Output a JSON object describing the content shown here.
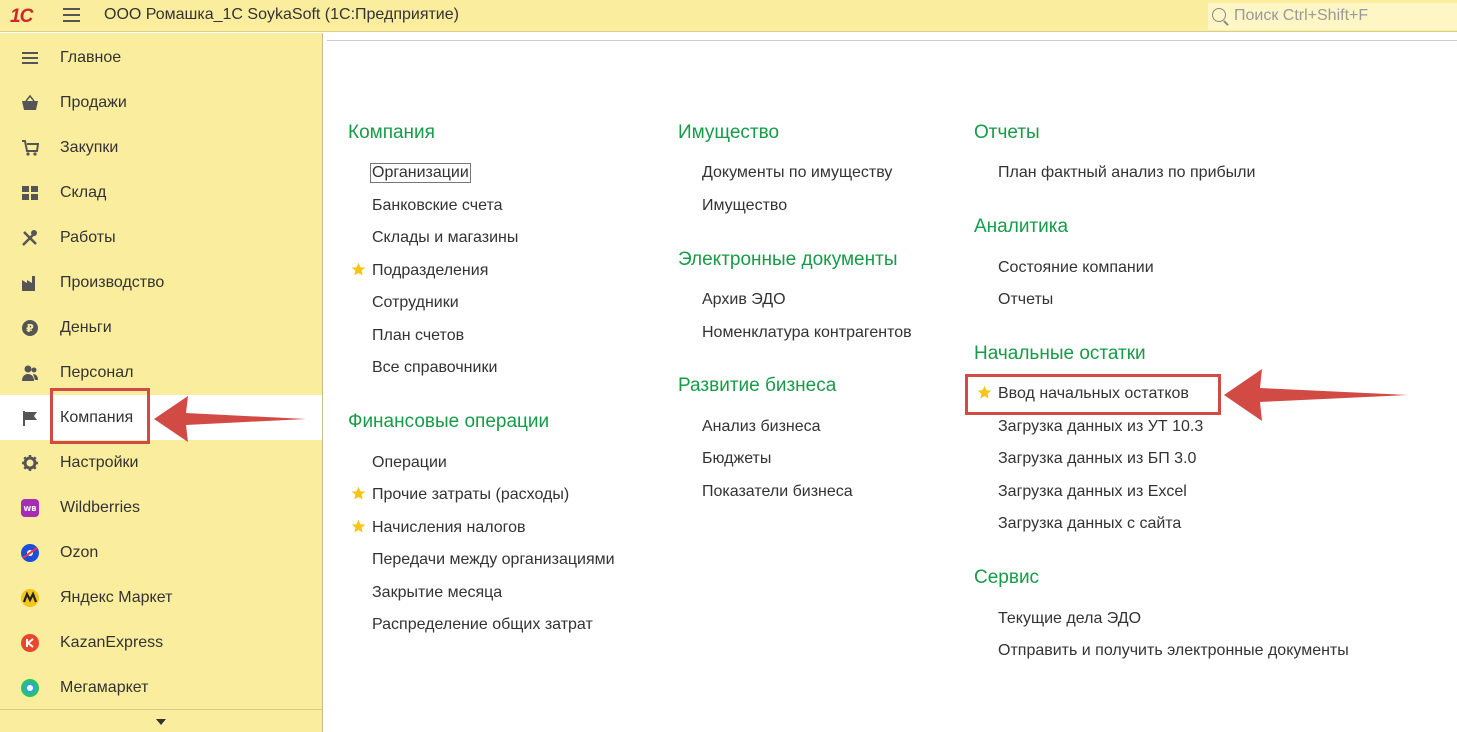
{
  "header": {
    "logo": "1С",
    "title": "ООО Ромашка_1С SoykaSoft  (1С:Предприятие)",
    "search_placeholder": "Поиск Ctrl+Shift+F"
  },
  "sidebar": {
    "items": [
      {
        "label": "Главное",
        "icon": "menu-list-icon"
      },
      {
        "label": "Продажи",
        "icon": "basket-icon"
      },
      {
        "label": "Закупки",
        "icon": "cart-icon"
      },
      {
        "label": "Склад",
        "icon": "warehouse-icon"
      },
      {
        "label": "Работы",
        "icon": "tools-icon"
      },
      {
        "label": "Производство",
        "icon": "factory-icon"
      },
      {
        "label": "Деньги",
        "icon": "ruble-coin-icon"
      },
      {
        "label": "Персонал",
        "icon": "people-icon"
      },
      {
        "label": "Компания",
        "icon": "flag-icon",
        "active": true
      },
      {
        "label": "Настройки",
        "icon": "gear-icon"
      },
      {
        "label": "Wildberries",
        "icon": "wildberries-logo-icon"
      },
      {
        "label": "Ozon",
        "icon": "ozon-logo-icon"
      },
      {
        "label": "Яндекс Маркет",
        "icon": "yandex-market-logo-icon"
      },
      {
        "label": "KazanExpress",
        "icon": "kazanexpress-logo-icon"
      },
      {
        "label": "Мегамаркет",
        "icon": "megamarket-logo-icon"
      }
    ]
  },
  "main": {
    "col1": {
      "company": {
        "title": "Компания",
        "links": [
          "Организации",
          "Банковские счета",
          "Склады и магазины",
          "Подразделения",
          "Сотрудники",
          "План счетов",
          "Все справочники"
        ]
      },
      "finance": {
        "title": "Финансовые операции",
        "links": [
          "Операции",
          "Прочие затраты (расходы)",
          "Начисления налогов",
          "Передачи между организациями",
          "Закрытие месяца",
          "Распределение общих затрат"
        ]
      }
    },
    "col2": {
      "property": {
        "title": "Имущество",
        "links": [
          "Документы по имуществу",
          "Имущество"
        ]
      },
      "edocs": {
        "title": "Электронные документы",
        "links": [
          "Архив ЭДО",
          "Номенклатура контрагентов"
        ]
      },
      "business": {
        "title": "Развитие бизнеса",
        "links": [
          "Анализ бизнеса",
          "Бюджеты",
          "Показатели бизнеса"
        ]
      }
    },
    "col3": {
      "reports": {
        "title": "Отчеты",
        "links": [
          "План фактный анализ по прибыли"
        ]
      },
      "analytics": {
        "title": "Аналитика",
        "links": [
          "Состояние компании",
          "Отчеты"
        ]
      },
      "opening": {
        "title": "Начальные остатки",
        "links": [
          "Ввод начальных остатков",
          "Загрузка данных из УТ 10.3",
          "Загрузка данных из БП 3.0",
          "Загрузка данных из Excel",
          "Загрузка данных с сайта"
        ]
      },
      "service": {
        "title": "Сервис",
        "links": [
          "Текущие дела ЭДО",
          "Отправить и получить электронные документы"
        ]
      }
    }
  },
  "colors": {
    "panel": "#fbed9e",
    "section_heading": "#169b47",
    "highlight": "#d14b44",
    "star": "#f5c518"
  }
}
